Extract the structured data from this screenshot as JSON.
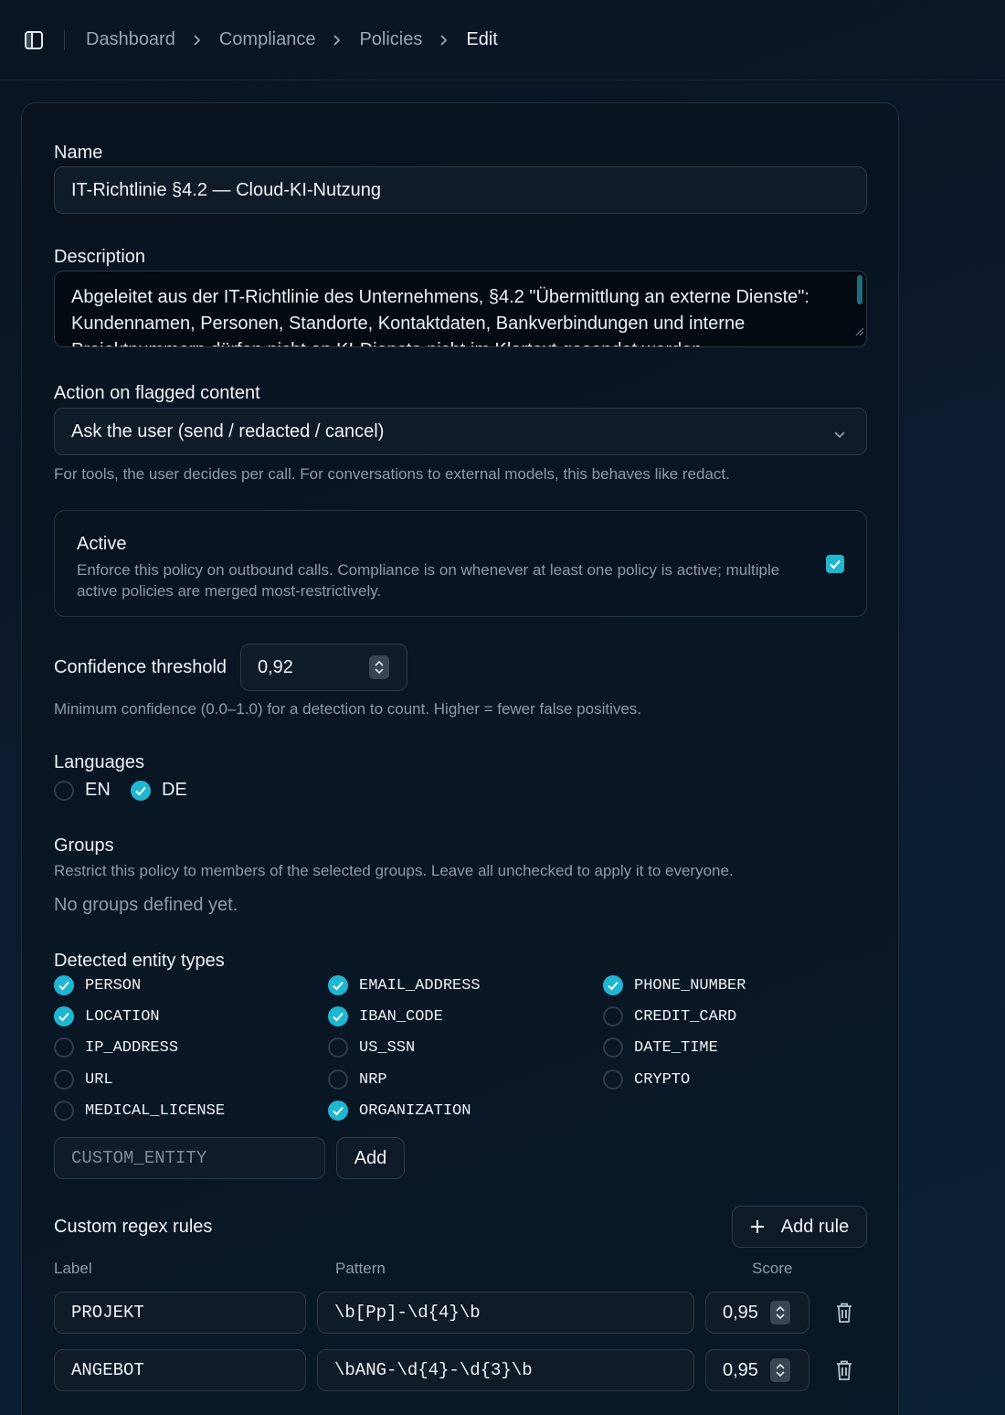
{
  "breadcrumb": {
    "items": [
      "Dashboard",
      "Compliance",
      "Policies"
    ],
    "current": "Edit"
  },
  "form": {
    "name_label": "Name",
    "name_value": "IT-Richtlinie §4.2 — Cloud-KI-Nutzung",
    "description_label": "Description",
    "description_value": "Abgeleitet aus der IT-Richtlinie des Unternehmens, §4.2 \"Übermittlung an externe Dienste\": Kundennamen, Personen, Standorte, Kontaktdaten, Bankverbindungen und interne Projektnummern dürfen nicht an KI-Dienste nicht im Klartext gesendet werden.",
    "action_label": "Action on flagged content",
    "action_value": "Ask the user (send / redacted / cancel)",
    "action_help": "For tools, the user decides per call. For conversations to external models, this behaves like redact.",
    "active": {
      "title": "Active",
      "description": "Enforce this policy on outbound calls. Compliance is on whenever at least one policy is active; multiple active policies are merged most-restrictively.",
      "checked": true
    },
    "threshold_label": "Confidence threshold",
    "threshold_value": "0,92",
    "threshold_help": "Minimum confidence (0.0–1.0) for a detection to count. Higher = fewer false positives.",
    "languages_label": "Languages",
    "languages": [
      {
        "label": "EN",
        "checked": false
      },
      {
        "label": "DE",
        "checked": true
      }
    ],
    "groups_label": "Groups",
    "groups_help": "Restrict this policy to members of the selected groups. Leave all unchecked to apply it to everyone.",
    "groups_empty": "No groups defined yet.",
    "entities_label": "Detected entity types",
    "entities": [
      {
        "label": "PERSON",
        "checked": true
      },
      {
        "label": "EMAIL_ADDRESS",
        "checked": true
      },
      {
        "label": "PHONE_NUMBER",
        "checked": true
      },
      {
        "label": "LOCATION",
        "checked": true
      },
      {
        "label": "IBAN_CODE",
        "checked": true
      },
      {
        "label": "CREDIT_CARD",
        "checked": false
      },
      {
        "label": "IP_ADDRESS",
        "checked": false
      },
      {
        "label": "US_SSN",
        "checked": false
      },
      {
        "label": "DATE_TIME",
        "checked": false
      },
      {
        "label": "URL",
        "checked": false
      },
      {
        "label": "NRP",
        "checked": false
      },
      {
        "label": "CRYPTO",
        "checked": false
      },
      {
        "label": "MEDICAL_LICENSE",
        "checked": false
      },
      {
        "label": "ORGANIZATION",
        "checked": true
      }
    ],
    "custom_entity_placeholder": "CUSTOM_ENTITY",
    "add_label": "Add",
    "regex_label": "Custom regex rules",
    "add_rule_label": "Add rule",
    "columns": {
      "label": "Label",
      "pattern": "Pattern",
      "score": "Score"
    },
    "rules": [
      {
        "label": "PROJEKT",
        "pattern": "\\b[Pp]-\\d{4}\\b",
        "score": "0,95"
      },
      {
        "label": "ANGEBOT",
        "pattern": "\\bANG-\\d{4}-\\d{3}\\b",
        "score": "0,95"
      }
    ]
  },
  "colors": {
    "accent": "#1fb6d2",
    "background": "#0b1a2c"
  },
  "icons": [
    "sidebar-toggle-icon",
    "chevron-right-icon",
    "chevron-down-icon",
    "check-icon",
    "stepper-icon",
    "plus-icon",
    "trash-icon"
  ]
}
